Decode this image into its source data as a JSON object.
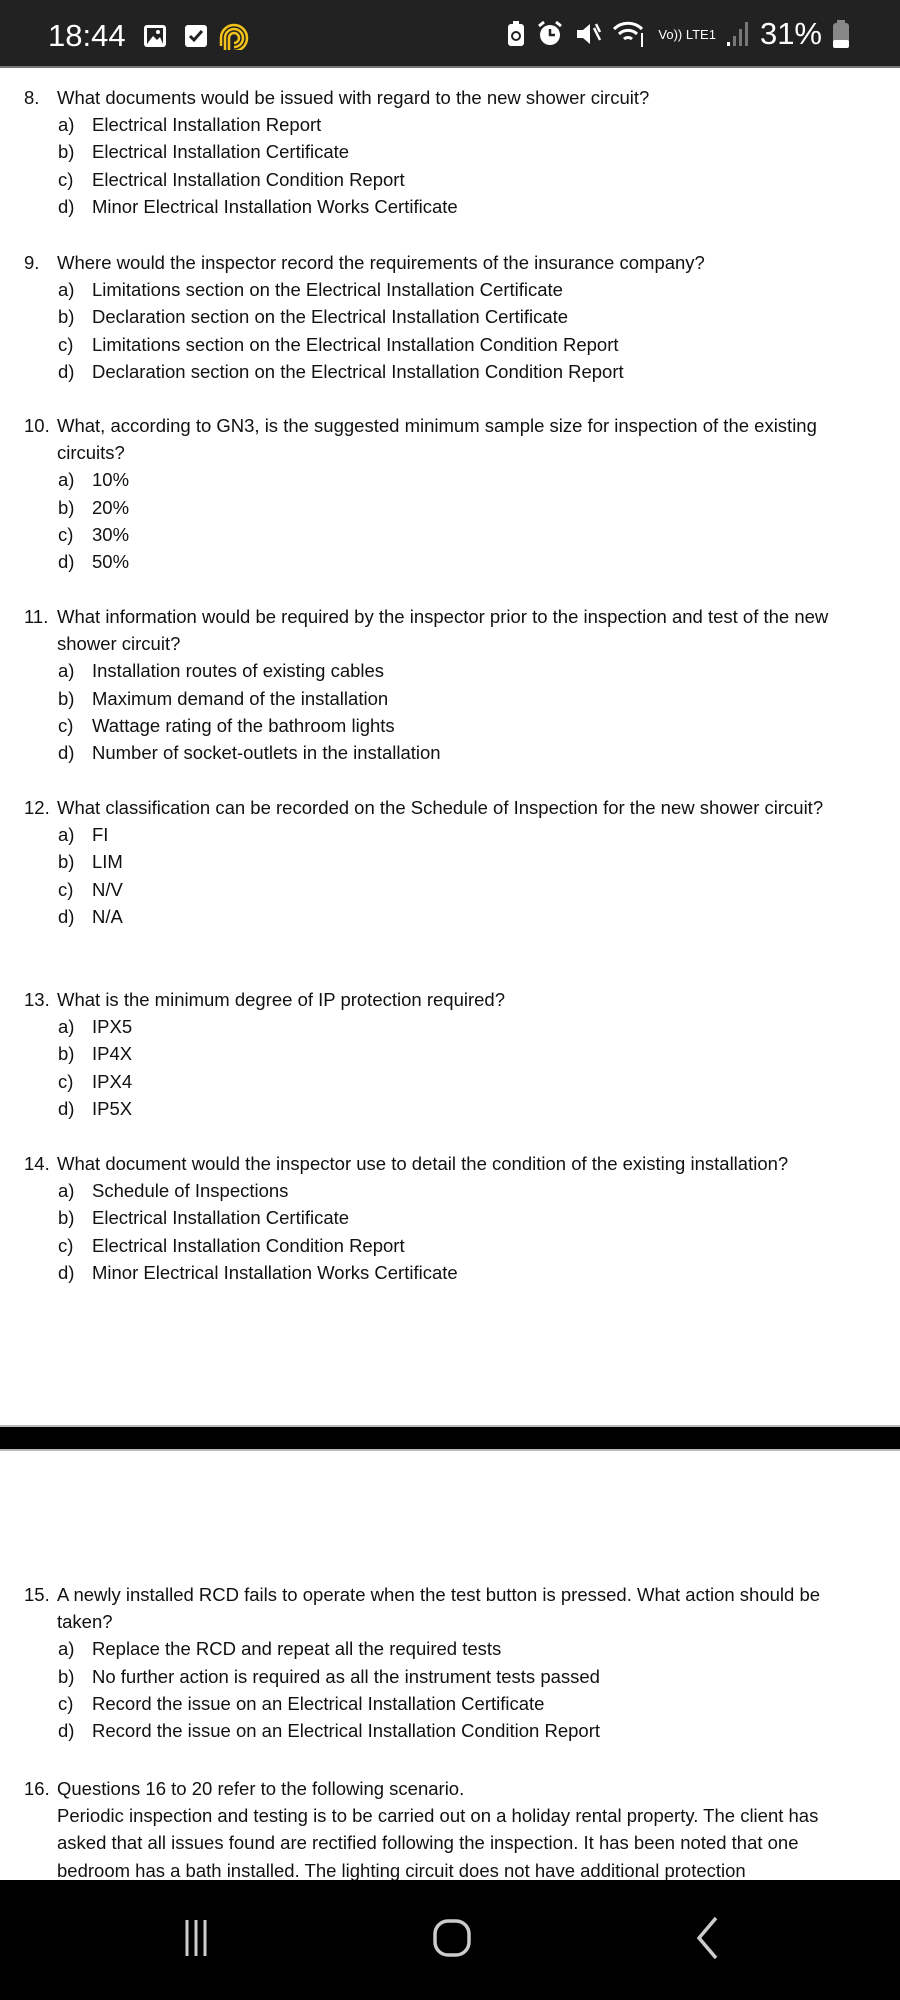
{
  "status_bar": {
    "time": "18:44",
    "network": "Vo)) LTE1",
    "battery": "31%",
    "icons": [
      "gallery-icon",
      "checkbox-icon",
      "fingerprint-app-icon",
      "battery-saver-icon",
      "alarm-icon",
      "mute-icon",
      "wifi-icon",
      "signal-icon",
      "battery-icon"
    ],
    "accent": "#f2c21b"
  },
  "questions": [
    {
      "num": "8.",
      "text": "What documents would be issued with regard to the new shower circuit?",
      "options": [
        [
          "a)",
          "Electrical Installation Report"
        ],
        [
          "b)",
          "Electrical Installation Certificate"
        ],
        [
          "c)",
          "Electrical Installation Condition Report"
        ],
        [
          "d)",
          "Minor Electrical Installation Works Certificate"
        ]
      ]
    },
    {
      "num": "9.",
      "text": "Where would the inspector record the requirements of the insurance company?",
      "options": [
        [
          "a)",
          "Limitations section on the Electrical Installation Certificate"
        ],
        [
          "b)",
          "Declaration section on the Electrical Installation Certificate"
        ],
        [
          "c)",
          "Limitations section on the Electrical Installation Condition Report"
        ],
        [
          "d)",
          "Declaration section on the Electrical Installation Condition Report"
        ]
      ]
    },
    {
      "num": "10.",
      "text": "What, according to GN3, is the suggested minimum sample size for inspection of the existing circuits?",
      "options": [
        [
          "a)",
          "10%"
        ],
        [
          "b)",
          "20%"
        ],
        [
          "c)",
          "30%"
        ],
        [
          "d)",
          "50%"
        ]
      ]
    },
    {
      "num": "11.",
      "text": "What information would be required by the inspector prior to the inspection and test of the new shower circuit?",
      "options": [
        [
          "a)",
          "Installation routes of existing cables"
        ],
        [
          "b)",
          "Maximum demand of the installation"
        ],
        [
          "c)",
          "Wattage rating of the bathroom lights"
        ],
        [
          "d)",
          "Number of socket-outlets in the installation"
        ]
      ]
    },
    {
      "num": "12.",
      "text": "What classification can be recorded on the Schedule of Inspection for the new shower circuit?",
      "options": [
        [
          "a)",
          "FI"
        ],
        [
          "b)",
          "LIM"
        ],
        [
          "c)",
          "N/V"
        ],
        [
          "d)",
          "N/A"
        ]
      ]
    },
    {
      "num": "13.",
      "text": "What is the minimum degree of IP protection required?",
      "options": [
        [
          "a)",
          "IPX5"
        ],
        [
          "b)",
          "IP4X"
        ],
        [
          "c)",
          "IPX4"
        ],
        [
          "d)",
          "IP5X"
        ]
      ]
    },
    {
      "num": "14.",
      "text": "What document would the inspector use to detail the condition of the existing installation?",
      "options": [
        [
          "a)",
          "Schedule of Inspections"
        ],
        [
          "b)",
          "Electrical Installation Certificate"
        ],
        [
          "c)",
          "Electrical Installation Condition Report"
        ],
        [
          "d)",
          "Minor Electrical Installation Works Certificate"
        ]
      ]
    },
    {
      "num": "15.",
      "text": "A newly installed RCD fails to operate when the test button is pressed. What action should be taken?",
      "options": [
        [
          "a)",
          "Replace the RCD and repeat all the required tests"
        ],
        [
          "b)",
          "No further action is required as all the instrument tests passed"
        ],
        [
          "c)",
          "Record the issue on an Electrical Installation Certificate"
        ],
        [
          "d)",
          "Record the issue on an Electrical Installation Condition Report"
        ]
      ]
    },
    {
      "num": "16.",
      "text": "Questions 16 to 20 refer to the following scenario.",
      "paragraph": "Periodic inspection and testing is to be carried out on a holiday rental property. The client has asked that all issues found are rectified following the inspection. It has been noted that one bedroom has a bath installed. The lighting circuit does not have additional protection",
      "options": []
    }
  ],
  "nav_bar": {
    "icons": [
      "recent-apps-icon",
      "home-icon",
      "back-icon"
    ]
  }
}
